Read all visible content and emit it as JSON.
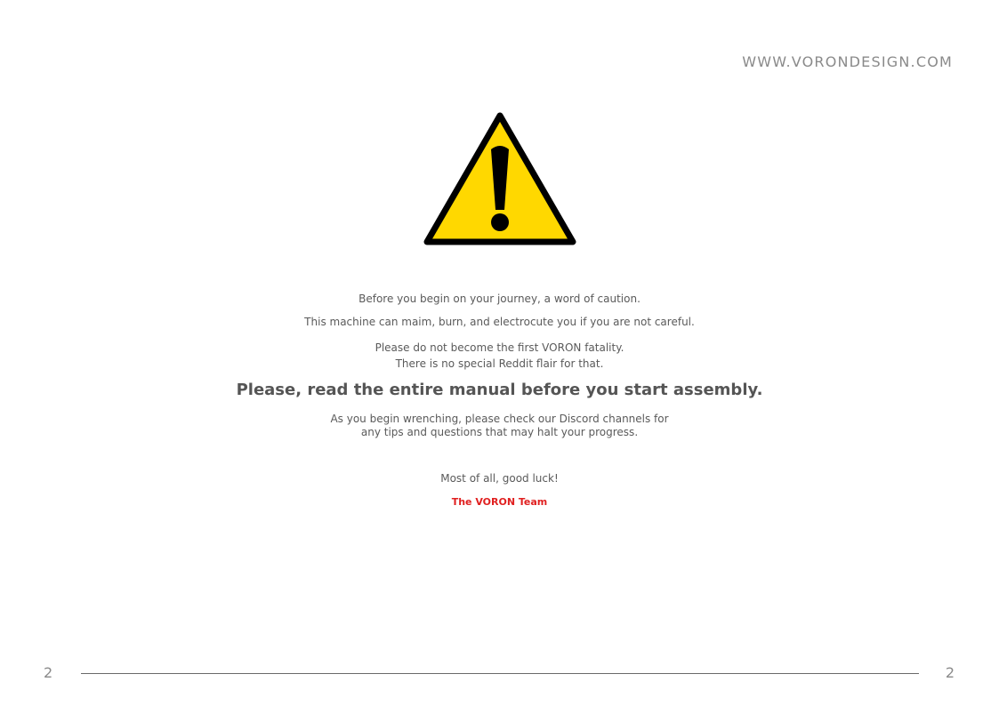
{
  "header": {
    "site_url": "WWW.VORONDESIGN.COM"
  },
  "warning": {
    "icon": "warning-triangle-icon",
    "colors": {
      "fill": "#FFD800",
      "stroke": "#000000"
    }
  },
  "body": {
    "line1": "Before you begin on your journey, a word of caution.",
    "line2": "This machine can maim, burn, and electrocute you if you are not careful.",
    "line3": "Please do not become the first VORON fatality.",
    "line4": "There is no special Reddit flair for that.",
    "headline": "Please, read the entire manual before you start assembly.",
    "line5": "As you begin wrenching, please check our Discord channels for",
    "line6": "any tips and questions that may halt your progress.",
    "line7": "Most of all, good luck!",
    "signature": "The VORON Team",
    "signature_color": "#E02020"
  },
  "footer": {
    "page_left": "2",
    "page_right": "2"
  }
}
